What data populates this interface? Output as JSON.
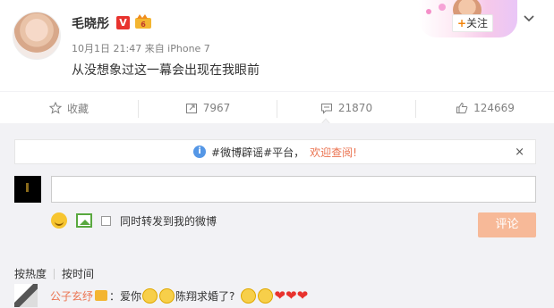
{
  "post": {
    "username": "毛晓彤",
    "v_badge": "V",
    "meta": "10月1日 21:47 来自 iPhone 7",
    "content": "从没想象过这一幕会出现在我眼前",
    "follow_plus": "+",
    "follow_label": "关注"
  },
  "actions": {
    "favorite_label": "收藏",
    "repost_count": "7967",
    "comment_count": "21870",
    "like_count": "124669"
  },
  "comment_panel": {
    "notice_text": "#微博辟谣#平台，",
    "notice_highlight": "欢迎查阅!",
    "notice_close": "×",
    "repost_checkbox_label": "同时转发到我的微博",
    "submit_label": "评论"
  },
  "sort": {
    "by_hot": "按热度",
    "by_time": "按时间"
  },
  "first_comment": {
    "user": "公子玄纾",
    "text_a": "：爱你",
    "text_b": "陈翔求婚了?"
  },
  "colors": {
    "accent_orange": "#eb7350",
    "follow_plus": "#f28308",
    "v_badge": "#e8332e",
    "panel_bg": "#f2f2f5",
    "submit_disabled": "#f7b998",
    "info_blue": "#5597e6"
  }
}
